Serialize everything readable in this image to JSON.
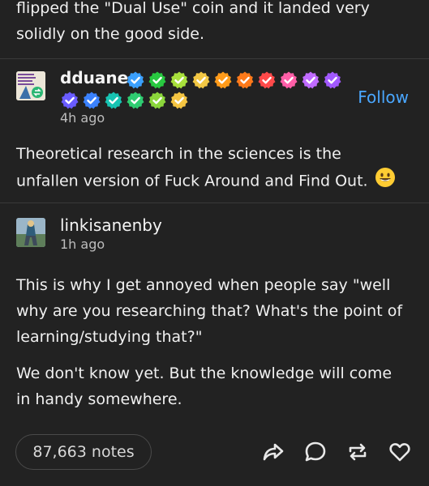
{
  "previous_post": {
    "line1": "flipped the \"Dual Use\" coin and it landed very",
    "line2": "solidly on the good side."
  },
  "reblog1": {
    "username": "dduane",
    "timestamp": "4h ago",
    "follow_label": "Follow",
    "line1": "Theoretical research in the sciences is the",
    "line2": "unfallen version of Fuck Around and Find Out.",
    "badge_colors": [
      "#3aa0ff",
      "#28c840",
      "#a8e03c",
      "#f2c744",
      "#ff9b1a",
      "#ff7a1a",
      "#ff4a4a",
      "#ff5fa8",
      "#c06bff",
      "#a259ff",
      "#6a5cff",
      "#3b82ff",
      "#17c3b2",
      "#2ecc71",
      "#8bd63b",
      "#f5c542"
    ]
  },
  "reblog2": {
    "username": "linkisanenby",
    "timestamp": "1h ago",
    "para1": [
      "This is why I get annoyed when people say \"well",
      "why are you researching that? What's the point of",
      "learning/studying that?\""
    ],
    "para2": [
      "We don't know yet. But the knowledge will come",
      "in handy somewhere."
    ]
  },
  "footer": {
    "notes_label": "87,663 notes"
  }
}
